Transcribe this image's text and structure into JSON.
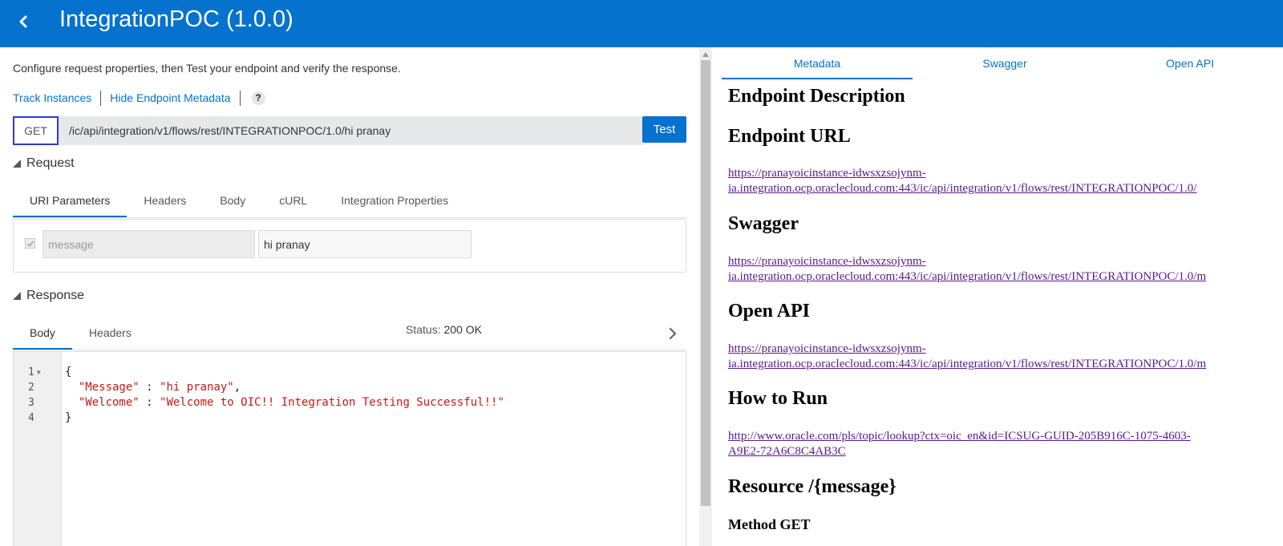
{
  "header": {
    "title": "IntegrationPOC (1.0.0)"
  },
  "left": {
    "intro": "Configure request properties, then Test your endpoint and verify the response.",
    "links": {
      "track": "Track Instances",
      "hide_meta": "Hide Endpoint Metadata",
      "help": "?"
    },
    "request_url": {
      "method": "GET",
      "url": "/ic/api/integration/v1/flows/rest/INTEGRATIONPOC/1.0/hi pranay",
      "test_label": "Test"
    },
    "request": {
      "heading": "Request",
      "tabs": [
        "URI Parameters",
        "Headers",
        "Body",
        "cURL",
        "Integration Properties"
      ],
      "active_tab": "URI Parameters",
      "param": {
        "name": "message",
        "value": "hi pranay",
        "checked": true
      }
    },
    "response": {
      "heading": "Response",
      "tabs": [
        "Body",
        "Headers"
      ],
      "active_tab": "Body",
      "status_label": "Status:",
      "status_value": "200 OK",
      "line_numbers": [
        "1",
        "2",
        "3",
        "4"
      ],
      "code_lines": [
        {
          "plain": "{",
          "key": "",
          "sep": "",
          "val": "",
          "tail": ""
        },
        {
          "plain": "  ",
          "key": "\"Message\"",
          "sep": " : ",
          "val": "\"hi pranay\"",
          "tail": ","
        },
        {
          "plain": "  ",
          "key": "\"Welcome\"",
          "sep": " : ",
          "val": "\"Welcome to OIC!! Integration Testing Successful!!\"",
          "tail": ""
        },
        {
          "plain": "}",
          "key": "",
          "sep": "",
          "val": "",
          "tail": ""
        }
      ]
    }
  },
  "right": {
    "tabs": [
      "Metadata",
      "Swagger",
      "Open API"
    ],
    "active_tab": "Metadata",
    "endpoint_description_heading": "Endpoint Description",
    "endpoint_url_heading": "Endpoint URL",
    "endpoint_url_line1": "https://pranayoicinstance-idwsxzsojynm-",
    "endpoint_url_line2": "ia.integration.ocp.oraclecloud.com:443/ic/api/integration/v1/flows/rest/INTEGRATIONPOC/1.0/",
    "swagger_heading": "Swagger",
    "swagger_line1": "https://pranayoicinstance-idwsxzsojynm-",
    "swagger_line2": "ia.integration.ocp.oraclecloud.com:443/ic/api/integration/v1/flows/rest/INTEGRATIONPOC/1.0/m",
    "openapi_heading": "Open API",
    "openapi_line1": "https://pranayoicinstance-idwsxzsojynm-",
    "openapi_line2": "ia.integration.ocp.oraclecloud.com:443/ic/api/integration/v1/flows/rest/INTEGRATIONPOC/1.0/m",
    "howto_heading": "How to Run",
    "howto_line1": "http://www.oracle.com/pls/topic/lookup?ctx=oic_en&id=ICSUG-GUID-205B916C-1075-4603-",
    "howto_line2": "A9E2-72A6C8C4AB3C",
    "resource_heading": "Resource /{message}",
    "method_heading": "Method GET"
  },
  "colors": {
    "header_bg": "#0572ce",
    "accent": "#0572ce",
    "method_border": "#2b3bcf",
    "json_string": "#c41a16",
    "visited_link": "#551a8b"
  },
  "icons": [
    "back-chevron-icon",
    "help-icon",
    "collapse-triangle-icon",
    "chevron-right-icon",
    "checkbox-check-icon",
    "fold-arrow-icon"
  ]
}
